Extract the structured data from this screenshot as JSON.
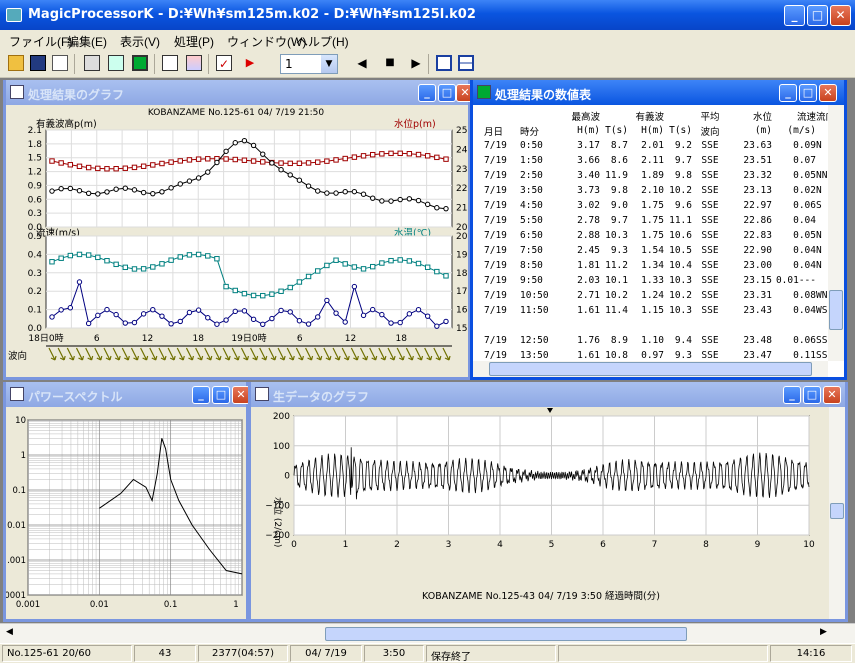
{
  "app": {
    "title": "MagicProcessorK - D:¥Wh¥sm125m.k02 - D:¥Wh¥sm125l.k02"
  },
  "menu": [
    "ファイル(F)",
    "編集(E)",
    "表示(V)",
    "処理(P)",
    "ウィンドウ(W)",
    "ヘルプ(H)"
  ],
  "toolbar": {
    "combo_value": "1",
    "icons": [
      "open-folder-icon",
      "save-icon",
      "new-file-icon",
      "calculator-icon",
      "report-icon",
      "monitor-icon",
      "list-icon",
      "graph-icon",
      "check-icon",
      "run-icon",
      "prev-icon",
      "stop-icon",
      "next-icon",
      "cascade-icon",
      "tile-icon"
    ]
  },
  "graph_window": {
    "title": "処理結果のグラフ",
    "header": "KOBANZAME No.125-61 04/ 7/19 21:50",
    "top_left_label": "有義波高p(m)",
    "top_right_label": "水位p(m)",
    "top_left_ticks": [
      "0.0",
      "0.3",
      "0.6",
      "0.9",
      "1.2",
      "1.5",
      "1.8",
      "2.1"
    ],
    "top_right_ticks": [
      "20",
      "21",
      "22",
      "23",
      "24",
      "25"
    ],
    "bot_left_label": "流速(m/s)",
    "bot_right_label": "水温(℃)",
    "bot_left_ticks": [
      "0.0",
      "0.1",
      "0.2",
      "0.3",
      "0.4",
      "0.5"
    ],
    "bot_right_ticks": [
      "15",
      "16",
      "17",
      "18",
      "19",
      "20"
    ],
    "x_ticks": [
      "18日0時",
      "6",
      "12",
      "18",
      "19日0時",
      "6",
      "12",
      "18"
    ],
    "wave_dir_label": "波向",
    "colors": {
      "waveheight": "#000000",
      "waterlevel": "#a00000",
      "current": "#000080",
      "watertemp": "#008080"
    }
  },
  "table_window": {
    "title": "処理結果の数値表",
    "headers": [
      [
        "",
        "",
        "最高波",
        "",
        "有義波",
        "",
        "平均",
        "水位",
        "流速",
        "流向"
      ],
      [
        "月日",
        "時分",
        "H(m)",
        "T(s)",
        "H(m)",
        "T(s)",
        "波向",
        "(m)",
        "(m/s)",
        ""
      ]
    ],
    "rows": [
      [
        "7/19",
        "0:50",
        "3.17",
        "8.7",
        "2.01",
        "9.2",
        "SSE",
        "23.63",
        "0.09",
        "N"
      ],
      [
        "7/19",
        "1:50",
        "3.66",
        "8.6",
        "2.11",
        "9.7",
        "SSE",
        "23.51",
        "0.07",
        ""
      ],
      [
        "7/19",
        "2:50",
        "3.40",
        "11.9",
        "1.89",
        "9.8",
        "SSE",
        "23.32",
        "0.05",
        "NN"
      ],
      [
        "7/19",
        "3:50",
        "3.73",
        "9.8",
        "2.10",
        "10.2",
        "SSE",
        "23.13",
        "0.02",
        "N"
      ],
      [
        "7/19",
        "4:50",
        "3.02",
        "9.0",
        "1.75",
        "9.6",
        "SSE",
        "22.97",
        "0.06",
        "S"
      ],
      [
        "7/19",
        "5:50",
        "2.78",
        "9.7",
        "1.75",
        "11.1",
        "SSE",
        "22.86",
        "0.04",
        ""
      ],
      [
        "7/19",
        "6:50",
        "2.88",
        "10.3",
        "1.75",
        "10.6",
        "SSE",
        "22.83",
        "0.05",
        "N"
      ],
      [
        "7/19",
        "7:50",
        "2.45",
        "9.3",
        "1.54",
        "10.5",
        "SSE",
        "22.90",
        "0.04",
        "N"
      ],
      [
        "7/19",
        "8:50",
        "1.81",
        "11.2",
        "1.34",
        "10.4",
        "SSE",
        "23.00",
        "0.04",
        "N"
      ],
      [
        "7/19",
        "9:50",
        "2.03",
        "10.1",
        "1.33",
        "10.3",
        "SSE",
        "23.15",
        "0.01---",
        ""
      ],
      [
        "7/19",
        "10:50",
        "2.71",
        "10.2",
        "1.24",
        "10.2",
        "SSE",
        "23.31",
        "0.08",
        "WN"
      ],
      [
        "7/19",
        "11:50",
        "1.61",
        "11.4",
        "1.15",
        "10.3",
        "SSE",
        "23.43",
        "0.04",
        "WS"
      ],
      [
        "",
        "",
        "",
        "",
        "",
        "",
        "",
        "",
        "",
        ""
      ],
      [
        "7/19",
        "12:50",
        "1.76",
        "8.9",
        "1.10",
        "9.4",
        "SSE",
        "23.48",
        "0.06",
        "SS"
      ],
      [
        "7/19",
        "13:50",
        "1.61",
        "10.8",
        "0.97",
        "9.3",
        "SSE",
        "23.47",
        "0.11",
        "SS"
      ]
    ]
  },
  "spectrum_window": {
    "title": "パワースペクトル",
    "y_ticks": [
      "10",
      "1",
      "0.1",
      "0.01",
      ".001",
      ".0001"
    ],
    "x_ticks": [
      "0.001",
      "0.01",
      "0.1",
      "1"
    ]
  },
  "raw_window": {
    "title": "生データのグラフ",
    "ylabel": "水位 (2/cm)",
    "y_ticks": [
      "200",
      "100",
      "0",
      "−100",
      "−200"
    ],
    "x_ticks": [
      "0",
      "1",
      "2",
      "3",
      "4",
      "5",
      "6",
      "7",
      "8",
      "9",
      "10"
    ],
    "footer": "KOBANZAME No.125-43 04/ 7/19  3:50  経過時間(分)"
  },
  "status": [
    "No.125-61 20/60",
    "43",
    "2377(04:57)",
    "04/ 7/19",
    "3:50",
    "保存終了",
    "",
    "14:16"
  ]
}
